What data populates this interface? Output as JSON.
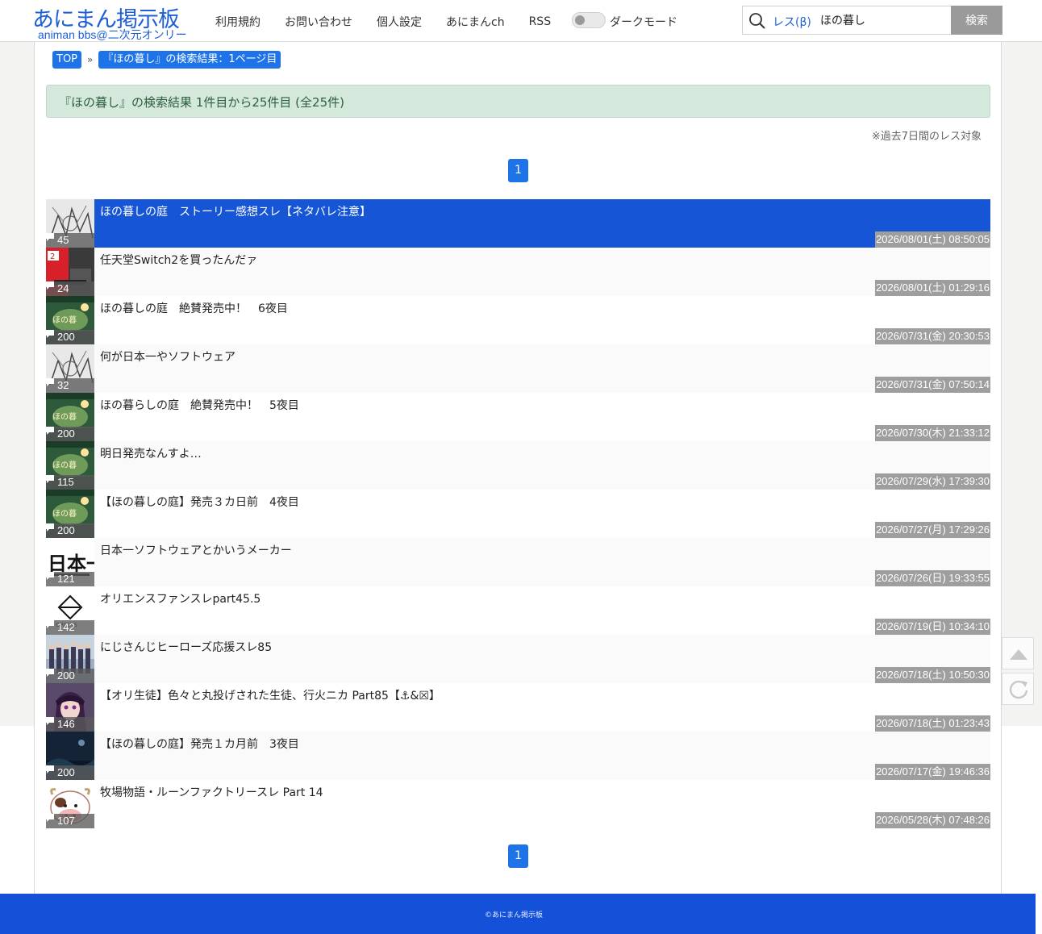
{
  "header": {
    "logo_main": "あにまん掲示板",
    "logo_sub": "animan bbs@二次元オンリー",
    "nav": [
      "利用規約",
      "お問い合わせ",
      "個人設定",
      "あにまんch",
      "RSS"
    ],
    "dark_mode_label": "ダークモード",
    "search_scope": "レス(β)",
    "search_value": "ほの暮し",
    "search_button": "検索"
  },
  "breadcrumb": {
    "top": "TOP",
    "sep": "»",
    "current": "『ほの暮し』の検索結果：1ページ目"
  },
  "notice": "『ほの暮し』の検索結果 1件目から25件目 (全25件)",
  "note": "※過去7日間のレス対象",
  "pagination": {
    "current": "1"
  },
  "threads": [
    {
      "title": "ほの暮しの庭　ストーリー感想スレ【ネタバレ注意】",
      "count": "45",
      "date": "2026/08/01(土) 08:50:05"
    },
    {
      "title": "任天堂Switch2を買ったんだァ",
      "count": "24",
      "date": "2026/08/01(土) 01:29:16"
    },
    {
      "title": "ほの暮しの庭　絶賛発売中！　6夜目",
      "count": "200",
      "date": "2026/07/31(金) 20:30:53"
    },
    {
      "title": "何が日本一やソフトウェア",
      "count": "32",
      "date": "2026/07/31(金) 07:50:14"
    },
    {
      "title": "ほの暮らしの庭　絶賛発売中！　5夜目",
      "count": "200",
      "date": "2026/07/30(木) 21:33:12"
    },
    {
      "title": "明日発売なんすよ…",
      "count": "115",
      "date": "2026/07/29(水) 17:39:30"
    },
    {
      "title": "【ほの暮しの庭】発売３カ日前　4夜目",
      "count": "200",
      "date": "2026/07/27(月) 17:29:26"
    },
    {
      "title": "日本一ソフトウェアとかいうメーカー",
      "count": "121",
      "date": "2026/07/26(日) 19:33:55"
    },
    {
      "title": "オリエンスファンスレpart45.5",
      "count": "142",
      "date": "2026/07/19(日) 10:34:10"
    },
    {
      "title": "にじさんじヒーローズ応援スレ85",
      "count": "200",
      "date": "2026/07/18(土) 10:50:30"
    },
    {
      "title": "【オリ生徒】色々と丸投げされた生徒、行火ニカ Part85【⚓&☒】",
      "count": "146",
      "date": "2026/07/18(土) 01:23:43"
    },
    {
      "title": "【ほの暮しの庭】発売１カ月前　3夜目",
      "count": "200",
      "date": "2026/07/17(金) 19:46:36"
    },
    {
      "title": "牧場物語・ルーンファクトリースレ Part 14",
      "count": "107",
      "date": "2026/05/28(木) 07:48:26"
    }
  ],
  "thumb_icons": [
    "manga-art-thumbnail",
    "switch2-box-thumbnail",
    "game-cover-thumbnail",
    "manga-art-thumbnail",
    "game-cover-thumbnail",
    "game-cover-thumbnail",
    "game-cover-thumbnail",
    "nippon-ichi-logo-thumbnail",
    "oriens-logo-thumbnail",
    "group-photo-thumbnail",
    "anime-girl-thumbnail",
    "dark-scene-thumbnail",
    "cow-mascot-thumbnail"
  ],
  "footer": "©あにまん掲示板",
  "colors": {
    "brand": "#1f5fd6",
    "accent": "#1e73e8",
    "selected": "#1656d6",
    "footer": "#1450d8"
  }
}
